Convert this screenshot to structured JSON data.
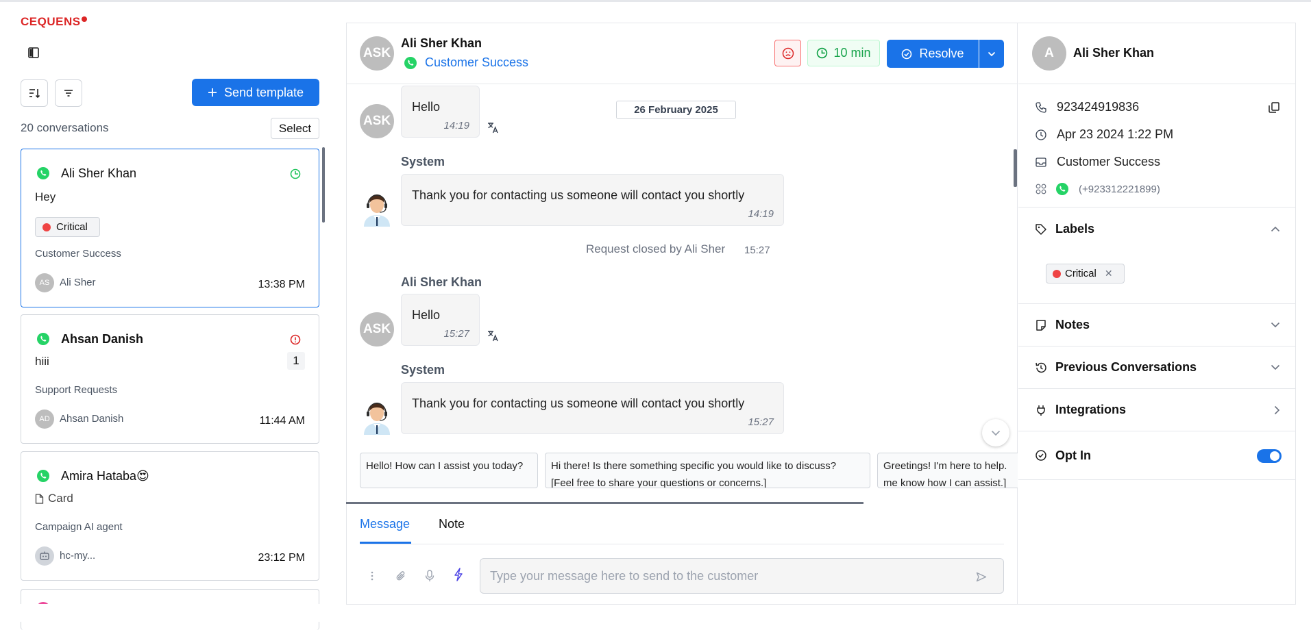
{
  "app": {
    "logo": "CEQUENS"
  },
  "sidebar": {
    "send_template_label": "Send template",
    "conversation_count": "20 conversations",
    "select_label": "Select",
    "conversations": [
      {
        "name": "Ali Sher Khan",
        "message": "Hey",
        "label": "Critical",
        "team": "Customer Success",
        "agent_initials": "AS",
        "agent": "Ali Sher",
        "time": "13:38 PM"
      },
      {
        "name": "Ahsan Danish",
        "message": "hiii",
        "unread": "1",
        "team": "Support Requests",
        "agent_initials": "AD",
        "agent": "Ahsan Danish",
        "time": "11:44 AM"
      },
      {
        "name": "Amira Hataba😍",
        "message": "Card",
        "team": "Campaign AI agent",
        "agent": "hc-my...",
        "time": "23:12 PM"
      }
    ]
  },
  "chat": {
    "header": {
      "initials": "ASK",
      "name": "Ali Sher Khan",
      "team": "Customer Success",
      "timer": "10 min",
      "resolve_label": "Resolve"
    },
    "date": "26 February 2025",
    "messages": [
      {
        "initials": "ASK",
        "text": "Hello",
        "time": "14:19"
      },
      {
        "sender": "System",
        "text": "Thank you for contacting us someone will contact you shortly",
        "time": "14:19"
      },
      {
        "sender": "Ali Sher Khan",
        "initials": "ASK",
        "text": "Hello",
        "time": "15:27"
      },
      {
        "sender": "System",
        "text": "Thank you for contacting us someone will contact you shortly",
        "time": "15:27"
      }
    ],
    "closed_note": "Request closed by Ali Sher",
    "closed_time": "15:27",
    "suggestions": [
      {
        "line1": "Hello! How can I assist you today?",
        "line2": ""
      },
      {
        "line1": "Hi there! Is there something specific you would like to discuss?",
        "line2": "[Feel free to share your questions or concerns.]"
      },
      {
        "line1": "Greetings! I'm here to help.",
        "line2": "me know how I can assist.]"
      }
    ],
    "tabs": {
      "message": "Message",
      "note": "Note"
    },
    "composer_placeholder": "Type your message here to send to the customer"
  },
  "contact": {
    "initial": "A",
    "name": "Ali Sher Khan",
    "phone": "923424919836",
    "created": "Apr 23 2024 1:22 PM",
    "inbox": "Customer Success",
    "channel_number": "(+923312221899)",
    "sections": {
      "labels": "Labels",
      "notes": "Notes",
      "previous": "Previous Conversations",
      "integrations": "Integrations",
      "opt_in": "Opt In"
    },
    "label_chip": "Critical",
    "opt_in_enabled": true
  },
  "colors": {
    "primary": "#1a73e8",
    "brand_red": "#dc2626",
    "whatsapp": "#25d366",
    "critical": "#ef4444"
  }
}
